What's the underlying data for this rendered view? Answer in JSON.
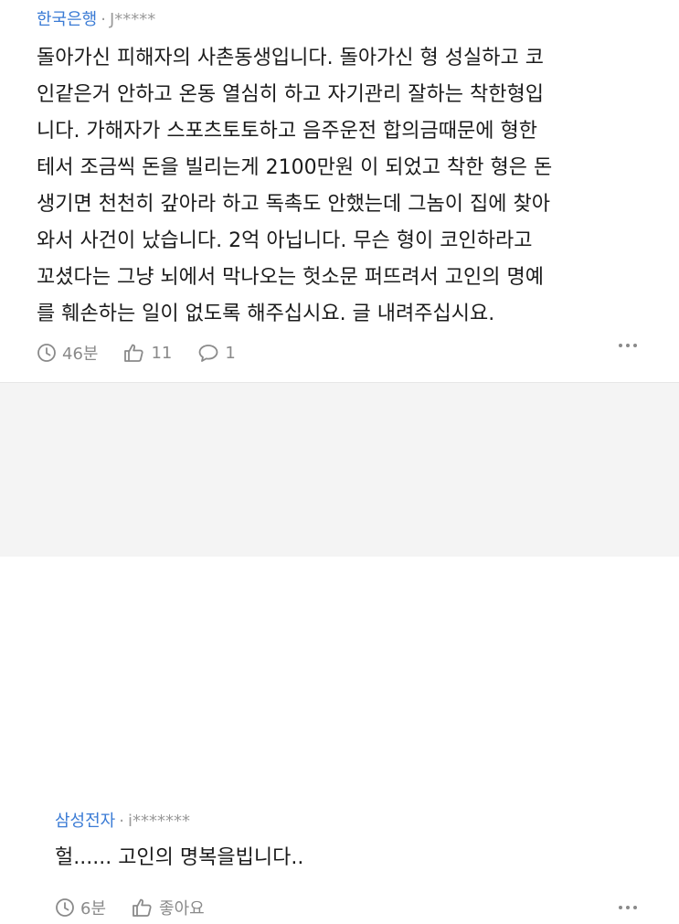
{
  "main_comment": {
    "author": "한국은행",
    "separator": "·",
    "user_id": "J*****",
    "lines": [
      "돌아가신 피해자의 사촌동생입니다. 돌아가신 형 성실하고 코",
      "인같은거 안하고 온동 열심히 하고 자기관리 잘하는 착한형입",
      "니다. 가해자가 스포츠토토하고 음주운전 합의금때문에 형한",
      "테서 조금씩 돈을 빌리는게 2100만원 이 되었고 착한 형은 돈",
      "생기면 천천히 갚아라 하고 독촉도 안했는데 그놈이 집에 찾아",
      "와서 사건이 났습니다. 2억 아닙니다. 무슨 형이 코인하라고",
      "꼬셨다는 그냥 뇌에서 막나오는 헛소문 퍼뜨려서 고인의 명예",
      "를 훼손하는 일이 없도록 해주십시요. 글 내려주십시요."
    ],
    "time": "46분",
    "likes": "11",
    "replies": "1"
  },
  "reply": {
    "author": "삼성전자",
    "separator": "·",
    "user_id": "i*******",
    "text": "헐...... 고인의 명복을빕니다..",
    "time": "6분",
    "like_label": "좋아요"
  },
  "icons": {
    "clock": "clock-icon",
    "thumb": "thumbs-up-icon",
    "bubble": "comment-bubble-icon",
    "more": "more-dots-icon"
  },
  "colors": {
    "author": "#3a7bd5",
    "meta": "#8a8a8a",
    "reply_bg": "#f4f4f4"
  }
}
